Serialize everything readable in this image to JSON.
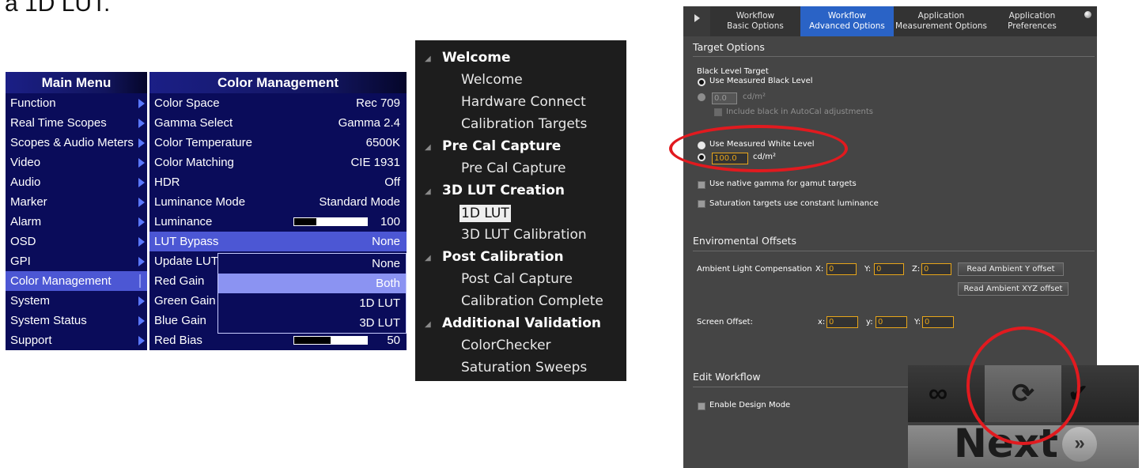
{
  "caption": "a 1D LUT.",
  "osd": {
    "left_title": "Main Menu",
    "right_title": "Color Management",
    "left_items": [
      "Function",
      "Real Time Scopes",
      "Scopes & Audio Meters",
      "Video",
      "Audio",
      "Marker",
      "Alarm",
      "OSD",
      "GPI",
      "Color Management",
      "System",
      "System Status",
      "Support"
    ],
    "right_items": [
      {
        "label": "Color Space",
        "value": "Rec 709"
      },
      {
        "label": "Gamma Select",
        "value": "Gamma 2.4"
      },
      {
        "label": "Color Temperature",
        "value": "6500K"
      },
      {
        "label": "Color Matching",
        "value": "CIE 1931"
      },
      {
        "label": "HDR",
        "value": "Off"
      },
      {
        "label": "Luminance Mode",
        "value": "Standard Mode"
      },
      {
        "label": "Luminance",
        "value": "100",
        "level": 0.3
      },
      {
        "label": "LUT Bypass",
        "value": "None"
      },
      {
        "label": "Update LUT",
        "value": ""
      },
      {
        "label": "Red Gain",
        "value": ""
      },
      {
        "label": "Green Gain",
        "value": ""
      },
      {
        "label": "Blue Gain",
        "value": ""
      },
      {
        "label": "Red Bias",
        "value": "50",
        "level": 0.5
      }
    ],
    "dropdown_options": [
      "None",
      "Both",
      "1D LUT",
      "3D LUT"
    ],
    "dropdown_selected": "Both"
  },
  "tree": {
    "groups": [
      {
        "title": "Welcome",
        "items": [
          "Welcome",
          "Hardware Connect",
          "Calibration Targets"
        ]
      },
      {
        "title": "Pre Cal Capture",
        "items": [
          "Pre Cal Capture"
        ]
      },
      {
        "title": "3D LUT Creation",
        "items": [
          "1D LUT",
          "3D LUT Calibration"
        ]
      },
      {
        "title": "Post Calibration",
        "items": [
          "Post Cal Capture",
          "Calibration Complete"
        ]
      },
      {
        "title": "Additional Validation",
        "items": [
          "ColorChecker",
          "Saturation Sweeps"
        ]
      }
    ],
    "selected": "1D LUT"
  },
  "panel": {
    "tabs": [
      {
        "line1": "Workflow",
        "line2": "Basic Options"
      },
      {
        "line1": "Workflow",
        "line2": "Advanced Options"
      },
      {
        "line1": "Application",
        "line2": "Measurement Options"
      },
      {
        "line1": "Application",
        "line2": "Preferences"
      }
    ],
    "active_tab": "Advanced Options",
    "target_options": "Target Options",
    "black_level_target": "Black Level Target",
    "use_measured_black": "Use Measured Black Level",
    "black_value": "0.0",
    "unit": "cd/m²",
    "include_black": "Include black in AutoCal adjustments",
    "use_measured_white": "Use Measured White Level",
    "white_value": "100.0",
    "native_gamma": "Use native gamma for gamut targets",
    "saturation_targets": "Saturation targets use constant luminance",
    "environmental_offsets": "Enviromental Offsets",
    "ambient_label": "Ambient Light Compensation",
    "ambient_x_label": "X:",
    "ambient_y_label": "Y:",
    "ambient_z_label": "Z:",
    "ambient_x": "0",
    "ambient_y": "0",
    "ambient_z": "0",
    "read_ambient_y": "Read Ambient Y offset",
    "read_ambient_xyz": "Read Ambient XYZ offset",
    "screen_offset_label": "Screen Offset:",
    "screen_x_label": "x:",
    "screen_y_label": "y:",
    "screen_Y_label": "Y:",
    "screen_x": "0",
    "screen_y": "0",
    "screen_Y": "0",
    "edit_workflow": "Edit Workflow",
    "enable_design_mode": "Enable Design Mode"
  },
  "zoom": {
    "next_label": "Next",
    "icons": [
      "infinity-icon",
      "sync-icon",
      "checkmark-icon",
      "double-chevron-right-icon"
    ]
  },
  "colors": {
    "accent_blue": "#2a63c6",
    "osd_navy": "#0a0c5a",
    "highlight_ring": "#e11a1f",
    "input_orange": "#e7a51a"
  }
}
